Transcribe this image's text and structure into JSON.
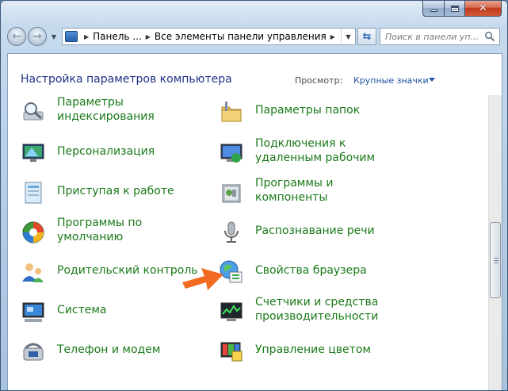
{
  "window": {
    "minimize_label": "minimize",
    "maximize_label": "maximize",
    "close_label": "close"
  },
  "address": {
    "segments": [
      "Панель ...",
      "Все элементы панели управления"
    ]
  },
  "search": {
    "placeholder": "Поиск в панели уп..."
  },
  "header": {
    "title": "Настройка параметров компьютера",
    "view_label": "Просмотр:",
    "view_value": "Крупные значки"
  },
  "items": {
    "indexing": "Параметры индексирования",
    "folder_options": "Параметры папок",
    "personalization": "Персонализация",
    "remote_connections": "Подключения к удаленным рабочим",
    "getting_started": "Приступая к работе",
    "programs": "Программы и компоненты",
    "default_programs": "Программы по умолчанию",
    "speech": "Распознавание речи",
    "parental": "Родительский контроль",
    "browser": "Свойства браузера",
    "system": "Система",
    "performance": "Счетчики и средства производительности",
    "phone_modem": "Телефон и модем",
    "color_mgmt": "Управление цветом"
  },
  "colors": {
    "link_green": "#1a7a1a",
    "title_blue": "#1e3287",
    "arrow_orange": "#f26b21"
  }
}
